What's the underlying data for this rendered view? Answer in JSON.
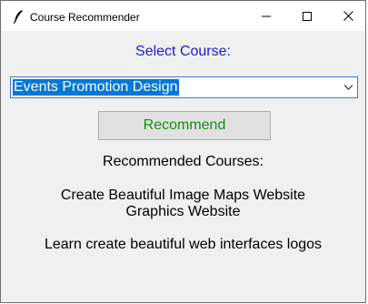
{
  "window": {
    "title": "Course Recommender",
    "icon": "feather-icon",
    "controls": [
      "minimize-icon",
      "maximize-icon",
      "close-icon"
    ]
  },
  "form": {
    "heading": "Select Course:",
    "selected_course": "Events Promotion Design",
    "button_label": "Recommend",
    "results_label": "Recommended Courses:"
  },
  "results": [
    {
      "line1": "Create Beautiful Image Maps Website",
      "line2": "Graphics Website"
    },
    {
      "line1": "Learn create beautiful web interfaces logos",
      "line2": ""
    }
  ],
  "colors": {
    "heading": "#1a1ad6",
    "button_text": "#138f13",
    "selection": "#0078d7"
  }
}
